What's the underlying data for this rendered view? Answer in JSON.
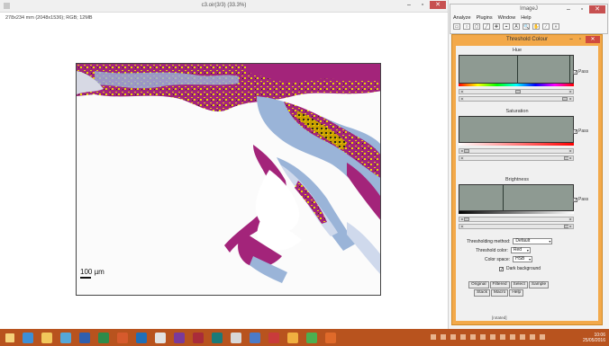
{
  "image_window": {
    "title": "c3.oir(3/3) (33.3%)",
    "info": "278x234 mm (2048x1536); RGB; 12MB",
    "scale_bar_label": "100 µm",
    "buttons": {
      "minimize": "–",
      "maximize": "▫",
      "close": "✕"
    }
  },
  "imagej": {
    "title": "ImageJ",
    "menus": [
      "Analyze",
      "Plugins",
      "Window",
      "Help"
    ],
    "tools": [
      "▭",
      "○",
      "⬠",
      "╱",
      "✚",
      "⌖",
      "A",
      "🔍",
      "✋",
      "∕",
      "»"
    ],
    "buttons": {
      "minimize": "–",
      "maximize": "▫",
      "close": "✕"
    }
  },
  "threshold": {
    "title": "Threshold Colour",
    "hue": {
      "label": "Hue",
      "pass_label": "Pass",
      "pass_checked": true,
      "slider1_value": "",
      "slider2_value": "",
      "min_fraction": 0.0,
      "max_fraction": 1.0
    },
    "saturation": {
      "label": "Saturation",
      "pass_label": "Pass",
      "pass_checked": true,
      "min_fraction": 0.0,
      "max_fraction": 1.0
    },
    "brightness": {
      "label": "Brightness",
      "pass_label": "Pass",
      "pass_checked": true,
      "min_fraction": 0.0,
      "max_fraction": 1.0
    },
    "thresholding_method_label": "Thresholding method:",
    "thresholding_method_value": "Default",
    "threshold_color_label": "Threshold color:",
    "threshold_color_value": "Red",
    "color_space_label": "Color space:",
    "color_space_value": "HSB",
    "dark_background_label": "Dark background",
    "dark_background_checked": true,
    "buttons_row1": [
      "Original",
      "Filtered",
      "Select",
      "Sample"
    ],
    "buttons_row2": [
      "Stack",
      "Macro",
      "Help"
    ],
    "status": "[rotated]"
  },
  "colors": {
    "dialog_frame": "#f3a94a",
    "taskbar": "#b8531e",
    "histogram_fill": "#8e9a92",
    "stain_magenta": "#a3247a",
    "stain_yellow": "#e8d800",
    "stain_blue": "#9ab4d8"
  },
  "taskbar": {
    "icons": [
      "ie-icon",
      "folder-icon",
      "store-icon",
      "word-icon",
      "excel-icon",
      "powerpoint-icon",
      "outlook-icon",
      "paint-icon",
      "onenote-icon",
      "access-icon",
      "publisher-icon",
      "imagej-icon",
      "explorer-icon",
      "ftp-icon",
      "notepad-icon",
      "green-app-icon",
      "java-icon"
    ],
    "time": "10:06",
    "date": "25/05/2016"
  }
}
